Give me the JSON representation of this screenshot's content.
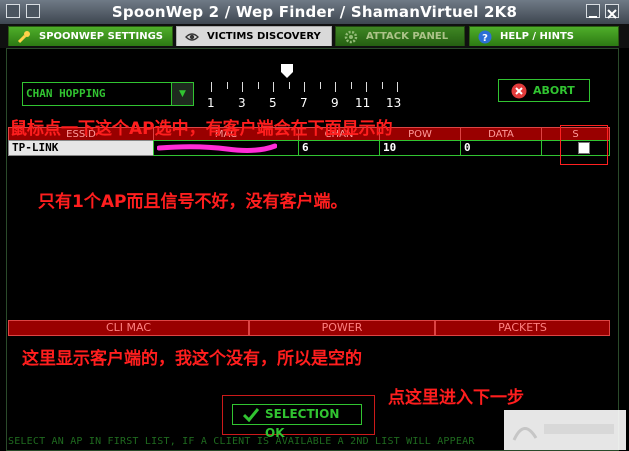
{
  "window": {
    "title": "SpoonWep 2 / Wep Finder / ShamanVirtuel 2K8"
  },
  "tabs": [
    {
      "label": "SPOONWEP SETTINGS",
      "icon": "wrench-icon"
    },
    {
      "label": "VICTIMS DISCOVERY",
      "icon": "eye-icon"
    },
    {
      "label": "ATTACK PANEL",
      "icon": "gear-icon"
    },
    {
      "label": "HELP / HINTS",
      "icon": "help-icon"
    }
  ],
  "controls": {
    "channel_mode": "CHAN HOPPING",
    "abort_label": "ABORT",
    "channel_ticks": [
      "1",
      "3",
      "5",
      "7",
      "9",
      "11",
      "13"
    ],
    "slider_value": 7
  },
  "ap_table": {
    "columns": [
      "ESSID",
      "MAC",
      "CHAN",
      "POW",
      "DATA",
      "S"
    ],
    "rows": [
      {
        "essid": "TP-LINK",
        "mac": "",
        "chan": "6",
        "power": "10",
        "data": "0"
      }
    ]
  },
  "client_table": {
    "columns": [
      "CLI MAC",
      "POWER",
      "PACKETS"
    ]
  },
  "annotations": {
    "top": "鼠标点一下这个AP选中，有客户端会在下面显示的",
    "middle": "只有1个AP而且信号不好，没有客户端。",
    "bottom": "这里显示客户端的，我这个没有，所以是空的",
    "next": "点这里进入下一步"
  },
  "selection_button": "SELECTION OK",
  "status_bar": "SELECT AN AP IN FIRST LIST, IF A CLIENT IS AVAILABLE A 2ND LIST WILL APPEAR",
  "colors": {
    "accent_green": "#31c431",
    "header_red": "#990000",
    "annotation_red": "#ff1e1e"
  }
}
